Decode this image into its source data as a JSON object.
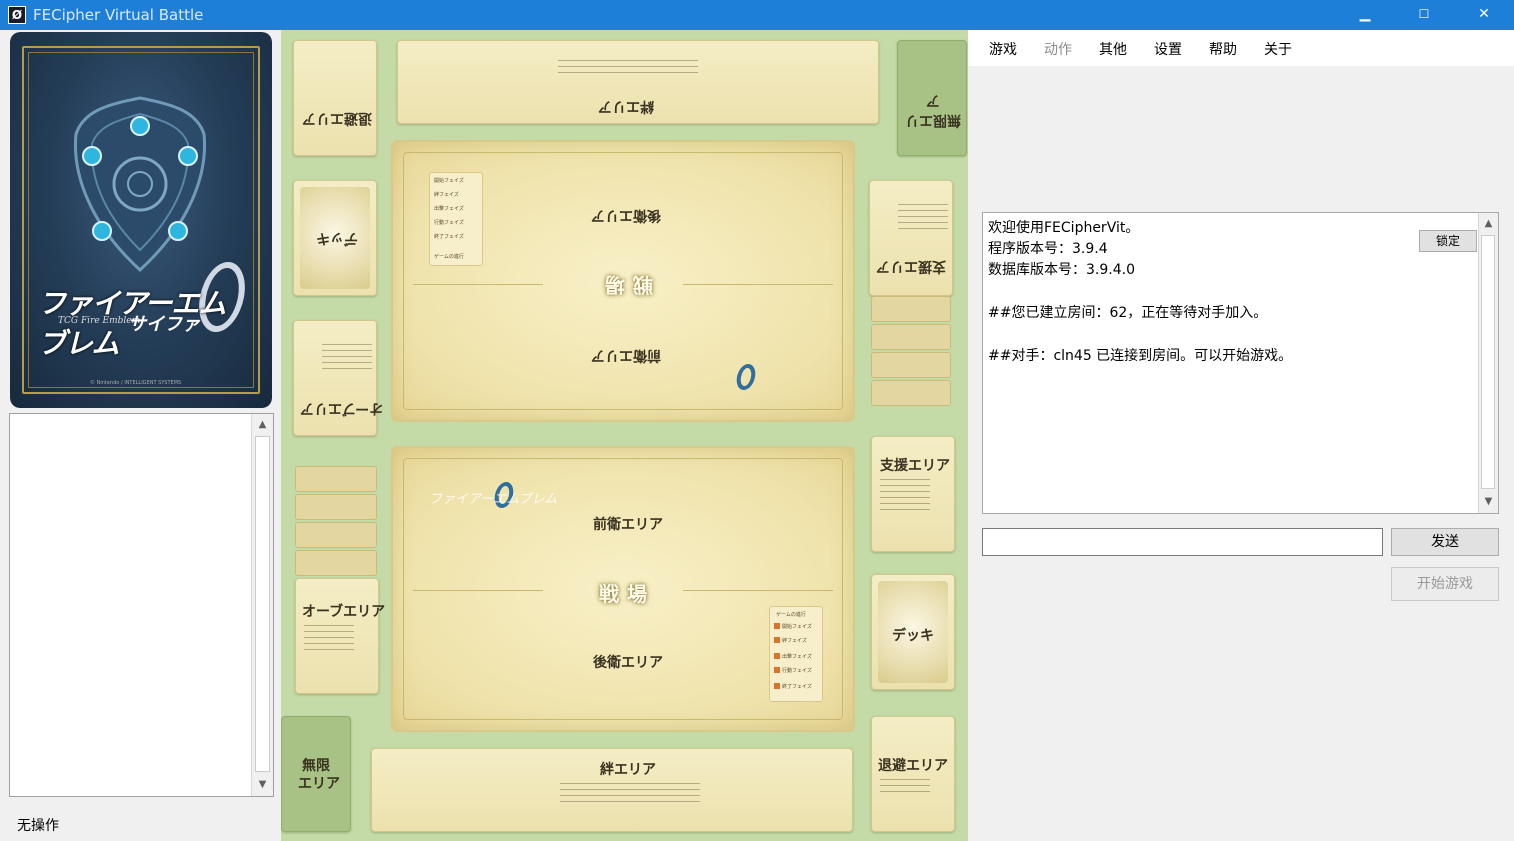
{
  "window": {
    "app_icon": "cipher-zero-icon",
    "title": "FECipher Virtual Battle",
    "minimize_label": "▁",
    "maximize_label": "☐",
    "close_label": "✕"
  },
  "card_preview": {
    "logo_title": "ファイアーエムブレム",
    "logo_subtitle": "TCG Fire Emblem",
    "logo_cipher": "サイファ",
    "credit": "© Nintendo / INTELLIGENT SYSTEMS"
  },
  "status": {
    "text": "无操作"
  },
  "board": {
    "retreat_area_opp": "退避エリア",
    "bond_area_opp": "絆エリア",
    "unlimited_area_opp": "無限エリア",
    "orb_area_opp": "オーブエリア",
    "deck_opp": "デッキ",
    "support_area_opp": "支援エリア",
    "back_line_opp": "後衛エリア",
    "front_line_opp": "前衛エリア",
    "battlefield_opp": "戦場",
    "front_line": "前衛エリア",
    "back_line": "後衛エリア",
    "battlefield": "戦場",
    "support_area": "支援エリア",
    "orb_area": "オーブエリア",
    "deck": "デッキ",
    "unlimited_area_line1": "無限",
    "unlimited_area_line2": "エリア",
    "bond_area": "絆エリア",
    "retreat_area": "退避エリア",
    "phase_title": "ゲームの進行",
    "phases": [
      "開始フェイズ",
      "絆フェイズ",
      "出撃フェイズ",
      "行動フェイズ",
      "終了フェイズ"
    ],
    "phases_opp": [
      "開始フェイズ",
      "絆フェイズ",
      "出撃フェイズ",
      "行動フェイズ",
      "終了フェイズ",
      "ゲームの進行"
    ]
  },
  "menu": {
    "items": [
      {
        "label": "游戏",
        "enabled": true
      },
      {
        "label": "动作",
        "enabled": false
      },
      {
        "label": "其他",
        "enabled": true
      },
      {
        "label": "设置",
        "enabled": true
      },
      {
        "label": "帮助",
        "enabled": true
      },
      {
        "label": "关于",
        "enabled": true
      }
    ]
  },
  "chat": {
    "lines": [
      "欢迎使用FECipherVit。",
      "程序版本号：3.9.4",
      "数据库版本号：3.9.4.0",
      "",
      "##您已建立房间：62，正在等待对手加入。",
      "",
      "##对手：cln45 已连接到房间。可以开始游戏。"
    ],
    "lock_label": "锁定",
    "input_value": "",
    "send_label": "发送",
    "start_label": "开始游戏"
  },
  "colors": {
    "titlebar": "#1e7fd9",
    "board_bg": "#c5dba7",
    "zone": "#f0e6b6",
    "phase_dot": "#d8742c"
  }
}
